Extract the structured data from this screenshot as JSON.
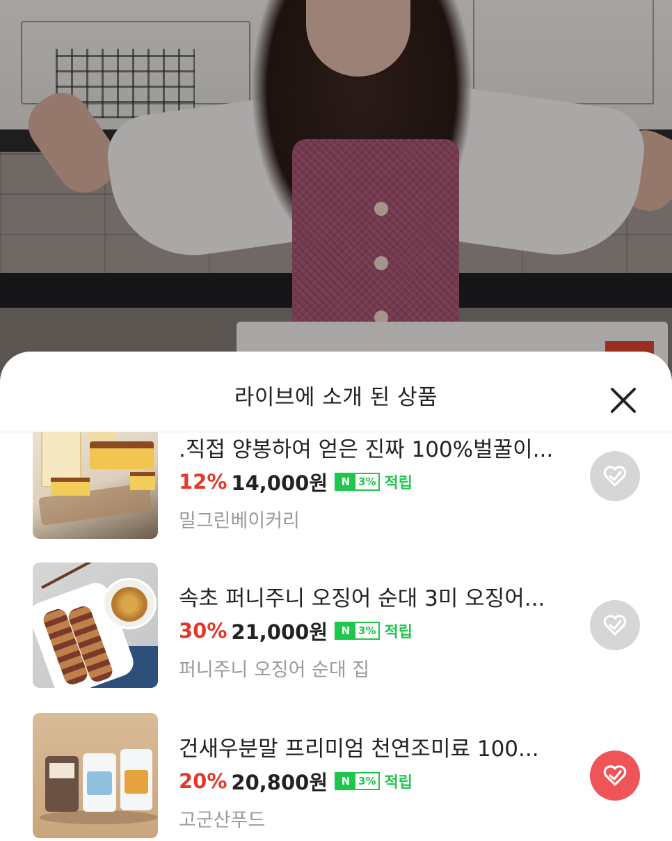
{
  "sheet": {
    "title": "라이브에 소개 된 상품",
    "close_icon": "close-icon"
  },
  "colors": {
    "discount": "#e3372a",
    "npay_green": "#1ec64d",
    "wish_active": "#ef5558",
    "wish_inactive": "#d6d6d6",
    "seller_gray": "#9a9a9a"
  },
  "products": [
    {
      "title": ".직접 양봉하여 얻은 진짜 100%벌꿀이...",
      "discount": "12%",
      "price": "14,000원",
      "npay_mark": "N",
      "npay_rate": "3%",
      "point_label": "적립",
      "seller": "밀그린베이커리",
      "thumbnail": "castella-cake-photo",
      "wishlisted": false
    },
    {
      "title": "속초 퍼니주니 오징어 순대 3미 오징어...",
      "discount": "30%",
      "price": "21,000원",
      "npay_mark": "N",
      "npay_rate": "3%",
      "point_label": "적립",
      "seller": "퍼니주니 오징어 순대 집",
      "thumbnail": "squid-sundae-photo",
      "wishlisted": false
    },
    {
      "title": "건새우분말 프리미엄 천연조미료 100...",
      "discount": "20%",
      "price": "20,800원",
      "npay_mark": "N",
      "npay_rate": "3%",
      "point_label": "적립",
      "seller": "고군산푸드",
      "thumbnail": "shrimp-powder-bags-photo",
      "wishlisted": true
    }
  ]
}
